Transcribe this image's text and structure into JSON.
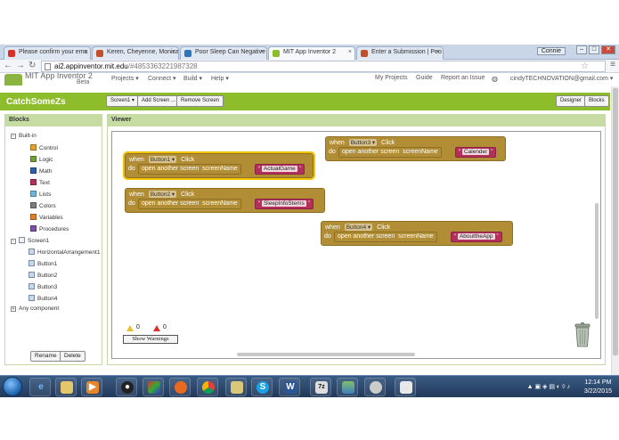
{
  "browser": {
    "tabs": [
      {
        "label": "Please confirm your ema",
        "icon": "gmail-icon",
        "color": "#d93025"
      },
      {
        "label": "Keren, Cheyenne, Monica",
        "icon": "trello-icon",
        "color": "#c0502b"
      },
      {
        "label": "Poor Sleep Can Negative",
        "icon": "site-icon",
        "color": "#2f73b8"
      },
      {
        "label": "MIT App Inventor 2",
        "icon": "appinventor-icon",
        "color": "#8dbd2b"
      },
      {
        "label": "Enter a Submission | Peo",
        "icon": "trello-icon",
        "color": "#c0502b"
      }
    ],
    "active_tab": 3,
    "profile_label": "Connie",
    "url_host": "ai2.appinventor.mit.edu",
    "url_path": "/#4853363221987328"
  },
  "app": {
    "title": "MIT App Inventor 2",
    "beta": "Beta",
    "menus": [
      "Projects ▾",
      "Connect ▾",
      "Build ▾",
      "Help ▾"
    ],
    "right_menus": [
      "My Projects",
      "Guide",
      "Report an Issue",
      "cindyTECHNOVATION@gmail.com ▾"
    ],
    "project_name": "CatchSomeZs",
    "screen_select": "Screen1 ▾",
    "add_screen": "Add Screen ...",
    "remove_screen": "Remove Screen",
    "designer": "Designer",
    "blocks": "Blocks"
  },
  "blocks_panel": {
    "title": "Blocks",
    "builtin": "Built-in",
    "builtin_items": [
      {
        "label": "Control",
        "color": "#e0a331"
      },
      {
        "label": "Logic",
        "color": "#74a03c"
      },
      {
        "label": "Math",
        "color": "#2f5fa8"
      },
      {
        "label": "Text",
        "color": "#b3305a"
      },
      {
        "label": "Lists",
        "color": "#71b6d9"
      },
      {
        "label": "Colors",
        "color": "#7c7c7c"
      },
      {
        "label": "Variables",
        "color": "#e07f2a"
      },
      {
        "label": "Procedures",
        "color": "#7a4fa5"
      }
    ],
    "screen": "Screen1",
    "components": [
      "HorizontalArrangement1",
      "Button1",
      "Button2",
      "Button3",
      "Button4"
    ],
    "any_component": "Any component",
    "rename": "Rename",
    "delete": "Delete"
  },
  "viewer": {
    "title": "Viewer",
    "labels": {
      "when": "when",
      "click": "Click",
      "do": "do",
      "open": "open another screen",
      "screen_name": "screenName"
    },
    "blocks": [
      {
        "button": "Button1",
        "screen": "ActualGame",
        "selected": true
      },
      {
        "button": "Button2",
        "screen": "SleepInfoStems",
        "selected": false
      },
      {
        "button": "Button3",
        "screen": "Calender",
        "selected": false
      },
      {
        "button": "Button4",
        "screen": "AbouttheApp",
        "selected": false
      }
    ],
    "warnings": "0",
    "errors": "0",
    "show_warnings": "Show Warnings"
  },
  "taskbar": {
    "time": "12:14 PM",
    "date": "3/22/2015"
  }
}
